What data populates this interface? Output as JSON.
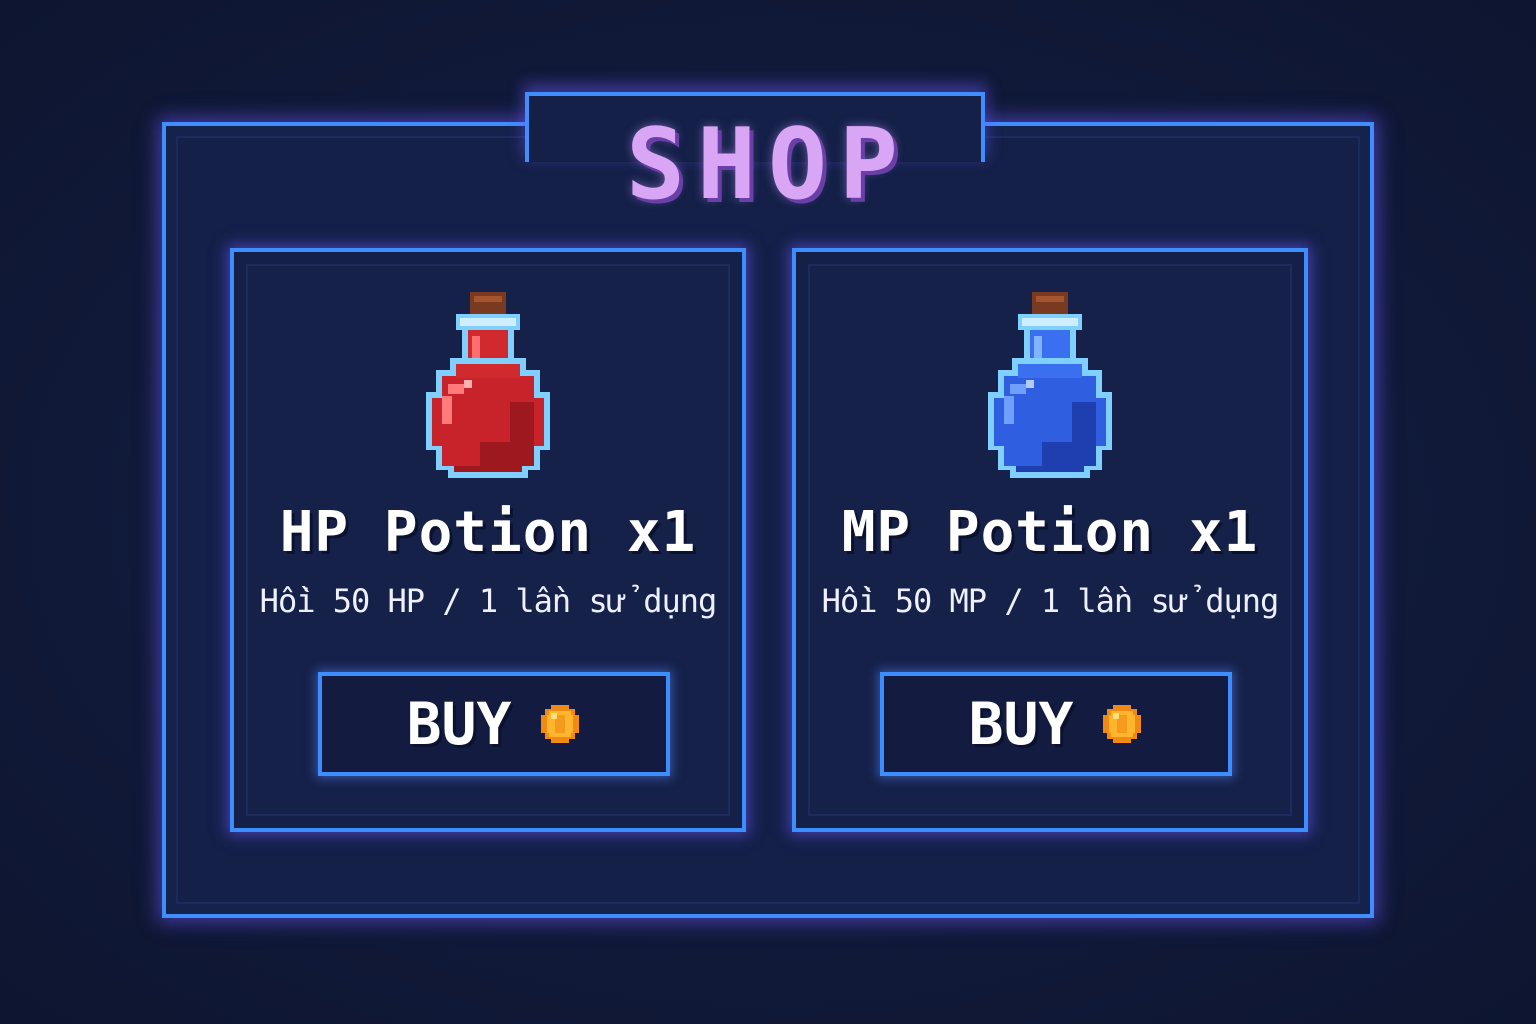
{
  "shop": {
    "title": "SHOP"
  },
  "items": [
    {
      "name": "HP Potion x1",
      "description": "Hồi 50 HP / 1 lần sử dụng",
      "buy_label": "BUY",
      "potion_icon": "red-potion-icon",
      "liquid_color": "#c8232a"
    },
    {
      "name": "MP Potion x1",
      "description": "Hồi 50 MP / 1 lần sử dụng",
      "buy_label": "BUY",
      "potion_icon": "blue-potion-icon",
      "liquid_color": "#2f5fe0"
    }
  ],
  "currency_icon": "gold-coin-icon",
  "colors": {
    "frame": "#3f8dff",
    "glow": "#6e5aff",
    "title": "#d8a6f5",
    "background": "#111a3a"
  }
}
